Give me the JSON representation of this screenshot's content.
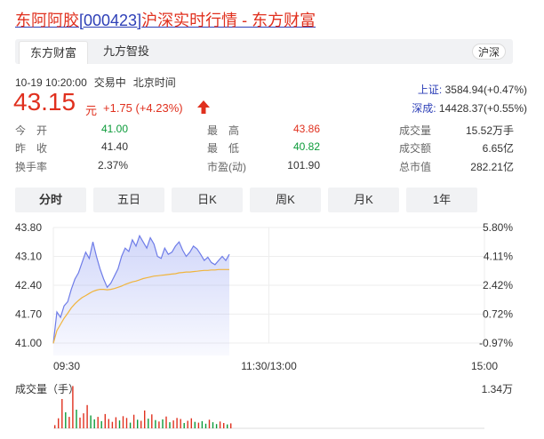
{
  "header": {
    "stock_name": "东阿阿胶",
    "stock_code": "[000423]",
    "title_suffix": "沪深实时行情 - 东方财富"
  },
  "source_tabs": {
    "items": [
      "东方财富",
      "九方智投"
    ],
    "active": 0,
    "market_badge": "沪深"
  },
  "quote": {
    "datetime": "10-19 10:20:00",
    "status": "交易中",
    "timezone": "北京时间",
    "price": "43.15",
    "unit": "元",
    "change": "+1.75 (+4.23%)",
    "direction": "up"
  },
  "indices": [
    {
      "name": "上证:",
      "value": "3584.94(+0.47%)"
    },
    {
      "name": "深成:",
      "value": "14428.37(+0.55%)"
    }
  ],
  "stats": {
    "open": {
      "label": "今　开",
      "value": "41.00",
      "color": "#0c9b3a"
    },
    "prev_close": {
      "label": "昨　收",
      "value": "41.40"
    },
    "turnover_rate": {
      "label": "换手率",
      "value": "2.37%"
    },
    "high": {
      "label": "最　高",
      "value": "43.86",
      "color": "#e0301e"
    },
    "low": {
      "label": "最　低",
      "value": "40.82",
      "color": "#0c9b3a"
    },
    "pe": {
      "label": "市盈(动)",
      "value": "101.90"
    },
    "volume": {
      "label": "成交量",
      "value": "15.52万手"
    },
    "amount": {
      "label": "成交额",
      "value": "6.65亿"
    },
    "market_cap": {
      "label": "总市值",
      "value": "282.21亿"
    }
  },
  "period_tabs": {
    "items": [
      "分时",
      "五日",
      "日K",
      "周K",
      "月K",
      "1年"
    ],
    "active": 0
  },
  "chart_data": {
    "type": "line",
    "price_ticks": [
      "43.80",
      "43.10",
      "42.40",
      "41.70",
      "41.00"
    ],
    "pct_ticks": [
      "5.80%",
      "4.11%",
      "2.42%",
      "0.72%",
      "-0.97%"
    ],
    "time_ticks": [
      "09:30",
      "11:30/13:00",
      "15:00"
    ],
    "ylim": [
      40.998,
      43.8
    ],
    "series": [
      {
        "color": "#6e7ce8",
        "values": [
          40.99,
          41.75,
          41.62,
          41.9,
          42.0,
          42.3,
          42.55,
          42.7,
          42.95,
          43.2,
          43.05,
          43.45,
          43.1,
          42.8,
          42.55,
          42.35,
          42.45,
          42.62,
          42.8,
          43.1,
          43.3,
          43.22,
          43.5,
          43.35,
          43.6,
          43.45,
          43.3,
          43.55,
          43.4,
          43.1,
          43.05,
          43.3,
          43.15,
          43.2,
          43.35,
          43.45,
          43.25,
          43.1,
          43.2,
          43.35,
          43.28,
          43.15,
          43.0,
          43.08,
          42.95,
          42.9,
          43.0,
          43.1,
          43.0,
          43.15
        ]
      },
      {
        "color": "#f0b43c",
        "values": [
          40.99,
          41.3,
          41.45,
          41.6,
          41.72,
          41.85,
          41.95,
          42.03,
          42.1,
          42.15,
          42.2,
          42.25,
          42.28,
          42.3,
          42.3,
          42.29,
          42.3,
          42.32,
          42.35,
          42.38,
          42.42,
          42.45,
          42.48,
          42.5,
          42.53,
          42.56,
          42.58,
          42.6,
          42.62,
          42.63,
          42.64,
          42.65,
          42.66,
          42.67,
          42.68,
          42.7,
          42.71,
          42.72,
          42.72,
          42.73,
          42.74,
          42.75,
          42.76,
          42.76,
          42.77,
          42.77,
          42.78,
          42.78,
          42.78,
          42.78
        ]
      }
    ],
    "volume_label": "成交量（手）",
    "volume_max": "1.34万",
    "volume_max_value": 13400,
    "volume": [
      {
        "v": 900,
        "up": true
      },
      {
        "v": 2800,
        "up": true
      },
      {
        "v": 8200,
        "up": true
      },
      {
        "v": 4500,
        "up": false
      },
      {
        "v": 3200,
        "up": true
      },
      {
        "v": 11800,
        "up": true
      },
      {
        "v": 5200,
        "up": false
      },
      {
        "v": 3000,
        "up": true
      },
      {
        "v": 4200,
        "up": true
      },
      {
        "v": 6500,
        "up": true
      },
      {
        "v": 3600,
        "up": false
      },
      {
        "v": 2500,
        "up": false
      },
      {
        "v": 3200,
        "up": true
      },
      {
        "v": 2000,
        "up": false
      },
      {
        "v": 4000,
        "up": true
      },
      {
        "v": 2600,
        "up": true
      },
      {
        "v": 1800,
        "up": true
      },
      {
        "v": 3100,
        "up": true
      },
      {
        "v": 2200,
        "up": false
      },
      {
        "v": 3400,
        "up": true
      },
      {
        "v": 2900,
        "up": true
      },
      {
        "v": 1600,
        "up": false
      },
      {
        "v": 3800,
        "up": true
      },
      {
        "v": 2400,
        "up": false
      },
      {
        "v": 2100,
        "up": true
      },
      {
        "v": 5000,
        "up": true
      },
      {
        "v": 2700,
        "up": false
      },
      {
        "v": 3900,
        "up": true
      },
      {
        "v": 2300,
        "up": false
      },
      {
        "v": 1900,
        "up": true
      },
      {
        "v": 2500,
        "up": false
      },
      {
        "v": 3300,
        "up": true
      },
      {
        "v": 1700,
        "up": false
      },
      {
        "v": 2200,
        "up": true
      },
      {
        "v": 2900,
        "up": true
      },
      {
        "v": 2600,
        "up": true
      },
      {
        "v": 1500,
        "up": false
      },
      {
        "v": 2100,
        "up": true
      },
      {
        "v": 2800,
        "up": true
      },
      {
        "v": 1800,
        "up": false
      },
      {
        "v": 1600,
        "up": true
      },
      {
        "v": 2000,
        "up": false
      },
      {
        "v": 1300,
        "up": false
      },
      {
        "v": 2400,
        "up": true
      },
      {
        "v": 1700,
        "up": false
      },
      {
        "v": 1200,
        "up": false
      },
      {
        "v": 1900,
        "up": true
      },
      {
        "v": 1500,
        "up": true
      },
      {
        "v": 1100,
        "up": false
      },
      {
        "v": 1400,
        "up": true
      }
    ]
  }
}
